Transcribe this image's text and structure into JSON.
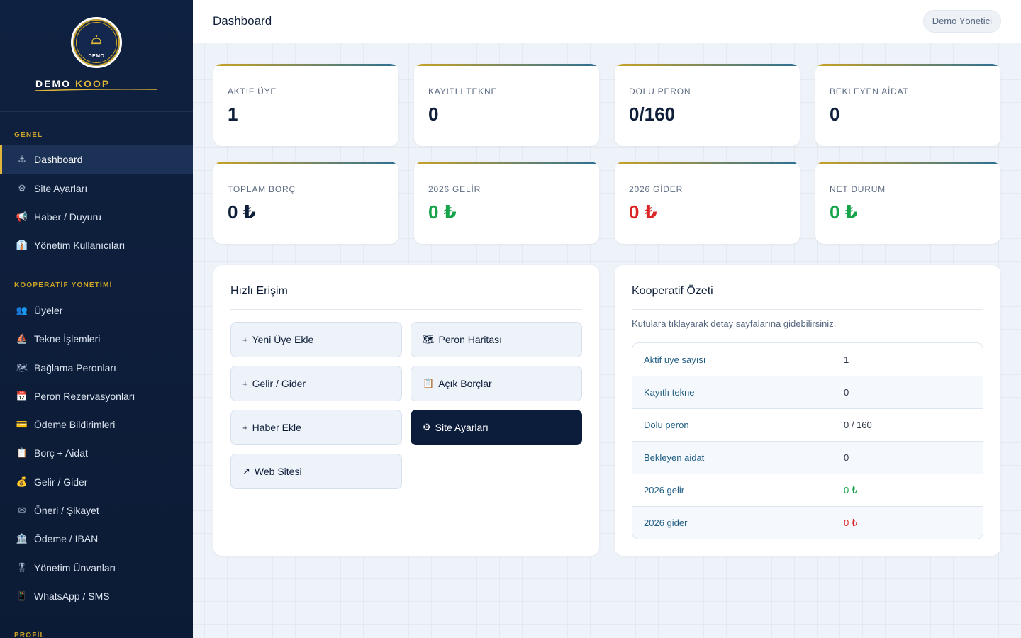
{
  "brand": {
    "logo_text": "DEMO",
    "name_main": "DEMO",
    "name_accent": "KOOP"
  },
  "sidebar": {
    "sections": [
      {
        "title": "GENEL",
        "items": [
          {
            "icon": "⚓",
            "icon_name": "anchor-icon",
            "label": "Dashboard",
            "active": true
          },
          {
            "icon": "⚙",
            "icon_name": "gear-icon",
            "label": "Site Ayarları"
          },
          {
            "icon": "📢",
            "icon_name": "megaphone-icon",
            "label": "Haber / Duyuru"
          },
          {
            "icon": "👔",
            "icon_name": "admin-users-icon",
            "label": "Yönetim Kullanıcıları"
          }
        ]
      },
      {
        "title": "KOOPERATİF YÖNETİMİ",
        "items": [
          {
            "icon": "👥",
            "icon_name": "members-icon",
            "label": "Üyeler"
          },
          {
            "icon": "⛵",
            "icon_name": "boat-icon",
            "label": "Tekne İşlemleri"
          },
          {
            "icon": "🗺",
            "icon_name": "map-icon",
            "label": "Bağlama Peronları"
          },
          {
            "icon": "📅",
            "icon_name": "calendar-icon",
            "label": "Peron Rezervasyonları"
          },
          {
            "icon": "💳",
            "icon_name": "card-icon",
            "label": "Ödeme Bildirimleri"
          },
          {
            "icon": "📋",
            "icon_name": "clipboard-icon",
            "label": "Borç + Aidat"
          },
          {
            "icon": "💰",
            "icon_name": "money-bag-icon",
            "label": "Gelir / Gider"
          },
          {
            "icon": "✉",
            "icon_name": "envelope-icon",
            "label": "Öneri / Şikayet"
          },
          {
            "icon": "🏦",
            "icon_name": "bank-icon",
            "label": "Ödeme / IBAN"
          },
          {
            "icon": "🎖",
            "icon_name": "medal-icon",
            "label": "Yönetim Ünvanları"
          },
          {
            "icon": "📱",
            "icon_name": "phone-icon",
            "label": "WhatsApp / SMS"
          }
        ]
      },
      {
        "title": "PROFİL",
        "items": []
      }
    ]
  },
  "header": {
    "title": "Dashboard",
    "user": "Demo Yönetici"
  },
  "stats": [
    {
      "label": "AKTİF ÜYE",
      "value": "1",
      "color": "#0f1f3a"
    },
    {
      "label": "KAYITLI TEKNE",
      "value": "0",
      "color": "#0f1f3a"
    },
    {
      "label": "DOLU PERON",
      "value": "0/160",
      "color": "#0f1f3a"
    },
    {
      "label": "BEKLEYEN AİDAT",
      "value": "0",
      "color": "#0f1f3a"
    },
    {
      "label": "TOPLAM BORÇ",
      "value": "0 ₺",
      "color": "#0f1f3a"
    },
    {
      "label": "2026 GELİR",
      "value": "0 ₺",
      "color": "#16a34a"
    },
    {
      "label": "2026 GİDER",
      "value": "0 ₺",
      "color": "#dc2626"
    },
    {
      "label": "NET DURUM",
      "value": "0 ₺",
      "color": "#16a34a"
    }
  ],
  "quick_access": {
    "title": "Hızlı Erişim",
    "buttons": [
      {
        "icon": "+",
        "icon_name": "plus-icon",
        "label": "Yeni Üye Ekle"
      },
      {
        "icon": "🗺",
        "icon_name": "map-icon",
        "label": "Peron Haritası"
      },
      {
        "icon": "+",
        "icon_name": "plus-icon",
        "label": "Gelir / Gider"
      },
      {
        "icon": "📋",
        "icon_name": "clipboard-icon",
        "label": "Açık Borçlar"
      },
      {
        "icon": "+",
        "icon_name": "plus-icon",
        "label": "Haber Ekle"
      },
      {
        "icon": "⚙",
        "icon_name": "gear-icon",
        "label": "Site Ayarları",
        "primary": true
      },
      {
        "icon": "↗",
        "icon_name": "external-link-icon",
        "label": "Web Sitesi"
      }
    ]
  },
  "summary": {
    "title": "Kooperatif Özeti",
    "note": "Kutulara tıklayarak detay sayfalarına gidebilirsiniz.",
    "rows": [
      {
        "key": "Aktif üye sayısı",
        "value": "1",
        "color": "#2a3547"
      },
      {
        "key": "Kayıtlı tekne",
        "value": "0",
        "color": "#2a3547"
      },
      {
        "key": "Dolu peron",
        "value": "0 / 160",
        "color": "#2a3547"
      },
      {
        "key": "Bekleyen aidat",
        "value": "0",
        "color": "#2a3547"
      },
      {
        "key": "2026 gelir",
        "value": "0 ₺",
        "color": "#16a34a"
      },
      {
        "key": "2026 gider",
        "value": "0 ₺",
        "color": "#dc2626"
      }
    ]
  }
}
